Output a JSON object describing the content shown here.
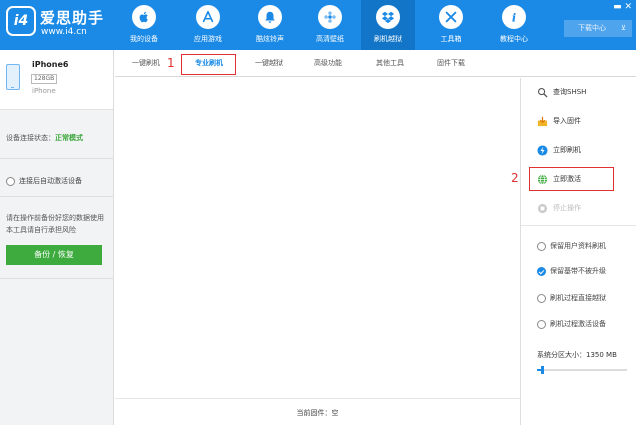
{
  "header": {
    "logo_badge": "i4",
    "logo_title": "爱思助手",
    "logo_url": "www.i4.cn",
    "nav": [
      {
        "label": "我的设备",
        "icon": "apple-icon"
      },
      {
        "label": "应用游戏",
        "icon": "app-store-icon"
      },
      {
        "label": "酷炫铃声",
        "icon": "bell-icon"
      },
      {
        "label": "高清壁纸",
        "icon": "flower-icon"
      },
      {
        "label": "刷机越狱",
        "icon": "dropbox-icon"
      },
      {
        "label": "工具箱",
        "icon": "tools-icon"
      },
      {
        "label": "教程中心",
        "icon": "info-icon"
      }
    ],
    "window_controls": "▬  ✕",
    "download_center": "下载中心",
    "download_arrow": "⊻"
  },
  "sidebar": {
    "device_name": "iPhone6",
    "device_storage": "128GB",
    "device_model": "iPhone",
    "conn_label": "设备连接状态：",
    "conn_value": "正常模式",
    "auto_activate": "连接后自动激活设备",
    "backup_note": "请在操作前备份好您的数据使用本工具请自行承担风险",
    "backup_button": "备份 / 恢复"
  },
  "tabs": [
    "一键刷机",
    "专业刷机",
    "一键越狱",
    "高级功能",
    "其他工具",
    "固件下载"
  ],
  "active_tab": "专业刷机",
  "annotations": {
    "tab_number": "1",
    "activate_number": "2"
  },
  "main": {
    "current_firmware": "当前固件：空"
  },
  "right_panel": {
    "actions": [
      {
        "label": "查询SHSH",
        "icon": "search-shsh-icon",
        "enabled": true
      },
      {
        "label": "导入固件",
        "icon": "import-icon",
        "enabled": true
      },
      {
        "label": "立即刷机",
        "icon": "flash-icon",
        "enabled": true
      },
      {
        "label": "立即激活",
        "icon": "globe-icon",
        "enabled": true
      },
      {
        "label": "停止操作",
        "icon": "stop-icon",
        "enabled": false
      }
    ],
    "options": [
      {
        "label": "保留用户资料刷机",
        "checked": false
      },
      {
        "label": "保留基带不被升级",
        "checked": true
      },
      {
        "label": "刷机过程直接越狱",
        "checked": false
      },
      {
        "label": "刷机过程激活设备",
        "checked": false
      }
    ],
    "partition_label": "系统分区大小：1350 MB",
    "partition_level": 0.04
  },
  "colors": {
    "accent": "#1a8ae6",
    "success": "#3dab3d",
    "highlight": "#e03030"
  }
}
